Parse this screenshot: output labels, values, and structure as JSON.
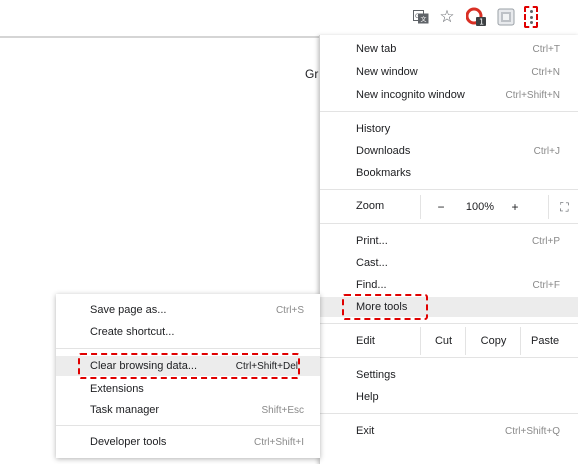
{
  "toolbar": {
    "icons": [
      "translate-icon",
      "star-icon",
      "extension-red-icon",
      "extension-grey-icon",
      "more-options-icon"
    ],
    "star_glyph": "☆",
    "ext_badge": "1"
  },
  "page": {
    "text_fragment": "Gr"
  },
  "main_menu": {
    "new_tab": {
      "label": "New tab",
      "shortcut": "Ctrl+T"
    },
    "new_window": {
      "label": "New window",
      "shortcut": "Ctrl+N"
    },
    "new_incognito": {
      "label": "New incognito window",
      "shortcut": "Ctrl+Shift+N"
    },
    "history": {
      "label": "History"
    },
    "downloads": {
      "label": "Downloads",
      "shortcut": "Ctrl+J"
    },
    "bookmarks": {
      "label": "Bookmarks"
    },
    "zoom": {
      "label": "Zoom",
      "minus": "−",
      "level": "100%",
      "plus": "+",
      "fullscreen": "⛶"
    },
    "print": {
      "label": "Print...",
      "shortcut": "Ctrl+P"
    },
    "cast": {
      "label": "Cast..."
    },
    "find": {
      "label": "Find...",
      "shortcut": "Ctrl+F"
    },
    "more_tools": {
      "label": "More tools"
    },
    "edit": {
      "label": "Edit",
      "cut": "Cut",
      "copy": "Copy",
      "paste": "Paste"
    },
    "settings": {
      "label": "Settings"
    },
    "help": {
      "label": "Help"
    },
    "exit": {
      "label": "Exit",
      "shortcut": "Ctrl+Shift+Q"
    }
  },
  "sub_menu": {
    "save_page": {
      "label": "Save page as...",
      "shortcut": "Ctrl+S"
    },
    "create_shortcut": {
      "label": "Create shortcut..."
    },
    "clear_browsing": {
      "label": "Clear browsing data...",
      "shortcut": "Ctrl+Shift+Del"
    },
    "extensions": {
      "label": "Extensions"
    },
    "task_manager": {
      "label": "Task manager",
      "shortcut": "Shift+Esc"
    },
    "developer_tools": {
      "label": "Developer tools",
      "shortcut": "Ctrl+Shift+I"
    }
  },
  "colors": {
    "highlight_dash": "#e00000",
    "hover_bg": "#ececec"
  }
}
